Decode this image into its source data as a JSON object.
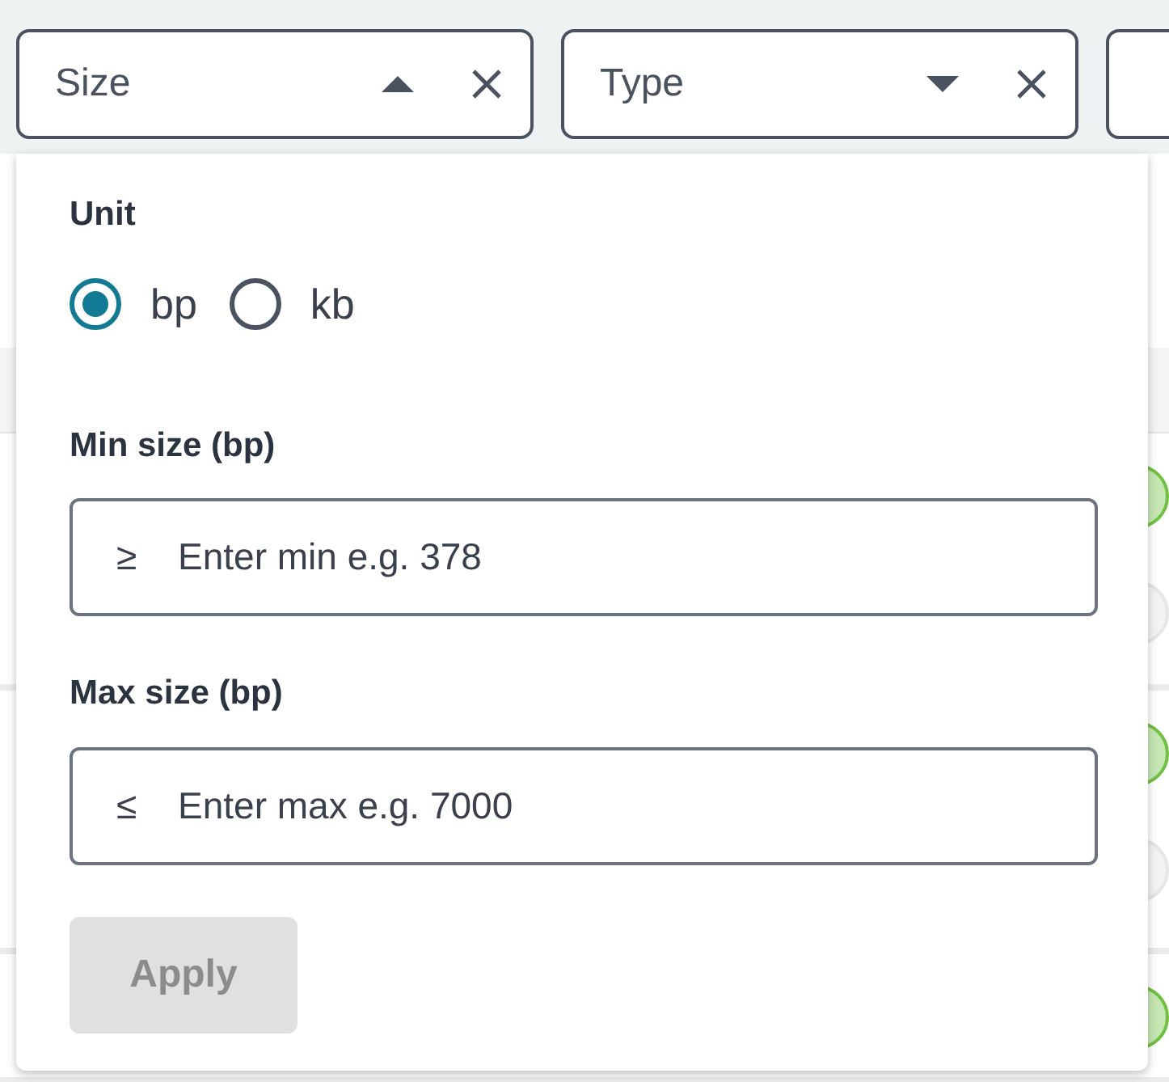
{
  "filters": [
    {
      "label": "Size",
      "open": true
    },
    {
      "label": "Type",
      "open": false
    }
  ],
  "table": {
    "rows": [
      {
        "dots": [
          {
            "color": "#c6e6b3"
          },
          {
            "color": "#f3f3f3"
          }
        ]
      },
      {
        "dots": [
          {
            "color": "#c6e6b3"
          },
          {
            "color": "#f3f3f3"
          }
        ]
      },
      {
        "dots": [
          {
            "color": "#c6e6b3"
          }
        ]
      }
    ]
  },
  "size_popup": {
    "unit_label": "Unit",
    "units": [
      {
        "label": "bp",
        "selected": true
      },
      {
        "label": "kb",
        "selected": false
      }
    ],
    "fields": [
      {
        "label": "Min size (bp)",
        "symbol": "≥",
        "placeholder": "Enter min e.g. 378"
      },
      {
        "label": "Max size (bp)",
        "symbol": "≤",
        "placeholder": "Enter max e.g. 7000"
      }
    ],
    "apply": {
      "label": "Apply",
      "disabled": true
    }
  }
}
